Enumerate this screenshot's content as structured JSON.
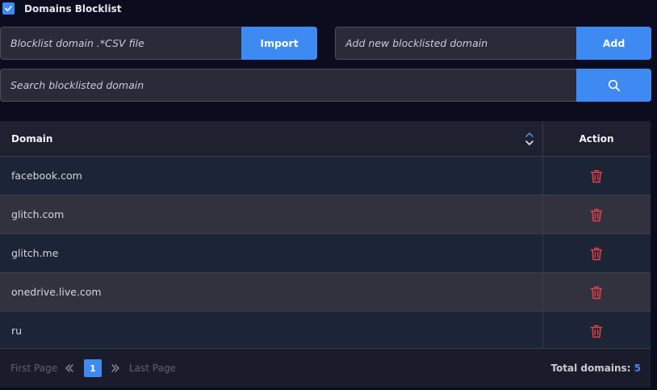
{
  "header": {
    "checkbox_checked": true,
    "title": "Domains Blocklist"
  },
  "import": {
    "placeholder": "Blocklist domain .*CSV file",
    "button_label": "Import"
  },
  "add": {
    "placeholder": "Add new blocklisted domain",
    "button_label": "Add"
  },
  "search": {
    "placeholder": "Search blocklisted domain",
    "icon": "search-icon"
  },
  "table": {
    "columns": [
      "Domain",
      "Action"
    ],
    "rows": [
      {
        "domain": "facebook.com",
        "action_icon": "trash-icon"
      },
      {
        "domain": "glitch.com",
        "action_icon": "trash-icon"
      },
      {
        "domain": "glitch.me",
        "action_icon": "trash-icon"
      },
      {
        "domain": "onedrive.live.com",
        "action_icon": "trash-icon"
      },
      {
        "domain": "ru",
        "action_icon": "trash-icon"
      }
    ]
  },
  "pagination": {
    "first_label": "First Page",
    "last_label": "Last Page",
    "current_page": "1",
    "total_label": "Total domains:",
    "total_count": "5"
  },
  "colors": {
    "accent": "#3d8bf2",
    "danger": "#e8404a",
    "background": "#0b0c1e"
  }
}
